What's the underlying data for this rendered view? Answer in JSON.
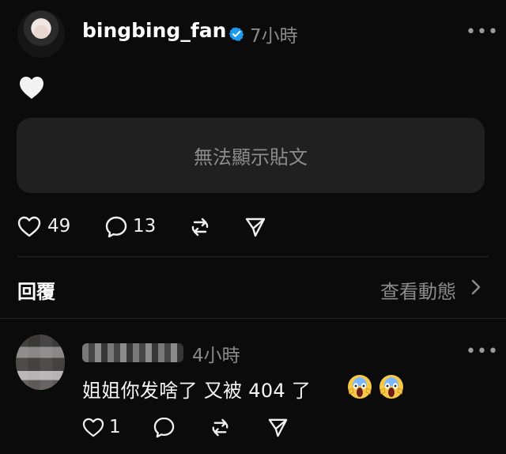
{
  "post": {
    "username": "bingbing_fan",
    "time": "7小時",
    "more": "•••",
    "unavailable_text": "無法顯示貼文",
    "likes": "49",
    "comments": "13"
  },
  "replies_section": {
    "title": "回覆",
    "view_activity": "查看動態"
  },
  "comment": {
    "time": "4小時",
    "text": "姐姐你发啥了 又被 404 了",
    "likes": "1",
    "more": "•••"
  },
  "colors": {
    "background": "#0b0b0b",
    "verified": "#1d9bf0",
    "muted": "#8a8a8a",
    "card": "#202020"
  },
  "icons": {
    "verified": "verified-badge-icon",
    "heart_emoji": "white-heart-emoji",
    "like": "heart-icon",
    "comment": "comment-icon",
    "repost": "repost-icon",
    "share": "share-icon",
    "chevron": "chevron-right-icon",
    "scream": "screaming-face-emoji"
  }
}
